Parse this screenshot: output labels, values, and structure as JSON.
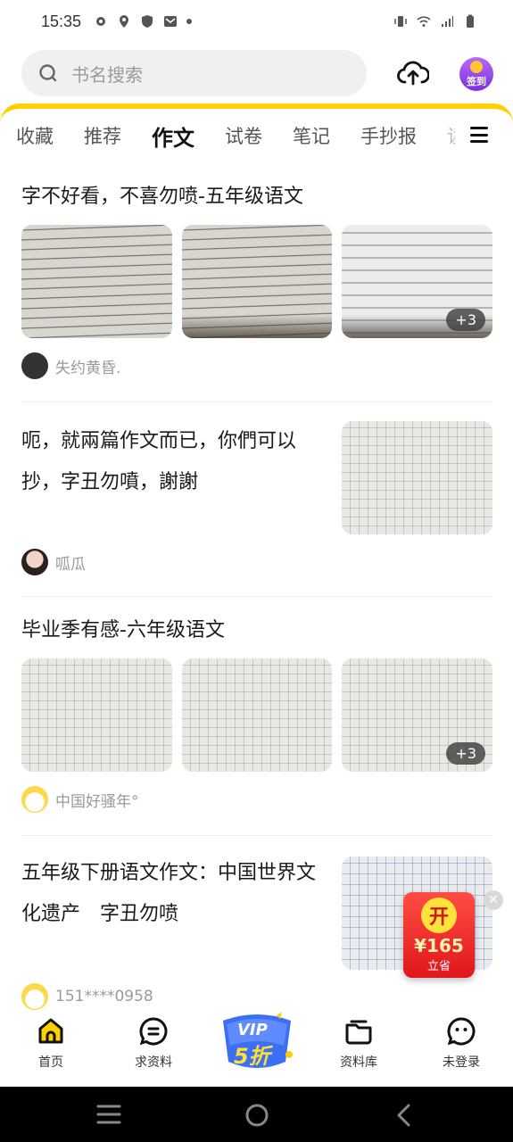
{
  "status_bar": {
    "time": "15:35"
  },
  "search": {
    "placeholder": "书名搜索"
  },
  "header": {
    "signin_label": "签到"
  },
  "tabs": [
    {
      "label": "收藏",
      "active": false
    },
    {
      "label": "推荐",
      "active": false
    },
    {
      "label": "作文",
      "active": true
    },
    {
      "label": "试卷",
      "active": false
    },
    {
      "label": "笔记",
      "active": false
    },
    {
      "label": "手抄报",
      "active": false
    },
    {
      "label": "读",
      "active": false
    }
  ],
  "posts": [
    {
      "title": "字不好看，不喜勿喷-五年级语文",
      "more_count": "+3",
      "author": "失约黄昏."
    },
    {
      "title": "呃，就兩篇作文而已，你們可以抄，字丑勿噴，謝謝",
      "author": "呱瓜"
    },
    {
      "title": "毕业季有感-六年级语文",
      "more_count": "+3",
      "author": "中国好骚年°"
    },
    {
      "title": "五年级下册语文作文：中国世界文化遗产　字丑勿喷",
      "author": "151****0958"
    }
  ],
  "red_packet": {
    "open_label": "开",
    "amount": "¥165",
    "label": "立省"
  },
  "bottom_nav": {
    "home": "首页",
    "request": "求资料",
    "vip_top": "VIP",
    "vip_bottom": "5折",
    "library": "资料库",
    "login": "未登录"
  },
  "colors": {
    "accent_yellow": "#ffd000",
    "vip_blue": "#3b6ff5",
    "red_packet": "#e0171b"
  }
}
